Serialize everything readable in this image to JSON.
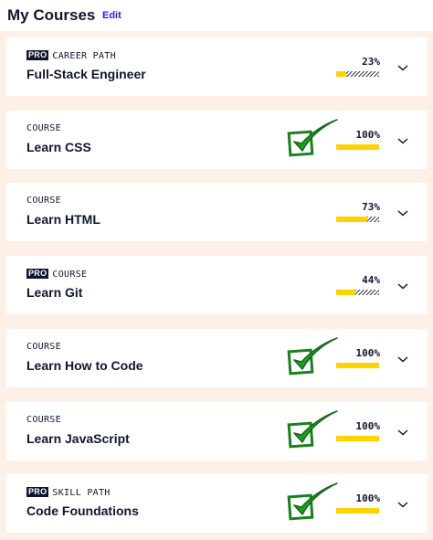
{
  "header": {
    "title": "My Courses",
    "edit_label": "Edit"
  },
  "colors": {
    "accent": "#3a10e5",
    "progress": "#ffd300",
    "check": "#1a8a1a",
    "background": "#fdf0e6"
  },
  "icons": {
    "expand": "chevron-down-icon",
    "completed": "checkmark-icon"
  },
  "courses": [
    {
      "pro": "PRO",
      "kind": "CAREER PATH",
      "title": "Full-Stack Engineer",
      "percent_label": "23%",
      "progress": 0.23,
      "completed": false
    },
    {
      "pro": "",
      "kind": "COURSE",
      "title": "Learn CSS",
      "percent_label": "100%",
      "progress": 1.0,
      "completed": true
    },
    {
      "pro": "",
      "kind": "COURSE",
      "title": "Learn HTML",
      "percent_label": "73%",
      "progress": 0.73,
      "completed": false
    },
    {
      "pro": "PRO",
      "kind": "COURSE",
      "title": "Learn Git",
      "percent_label": "44%",
      "progress": 0.44,
      "completed": false
    },
    {
      "pro": "",
      "kind": "COURSE",
      "title": "Learn How to Code",
      "percent_label": "100%",
      "progress": 1.0,
      "completed": true
    },
    {
      "pro": "",
      "kind": "COURSE",
      "title": "Learn JavaScript",
      "percent_label": "100%",
      "progress": 1.0,
      "completed": true
    },
    {
      "pro": "PRO",
      "kind": "SKILL PATH",
      "title": "Code Foundations",
      "percent_label": "100%",
      "progress": 1.0,
      "completed": true
    }
  ]
}
